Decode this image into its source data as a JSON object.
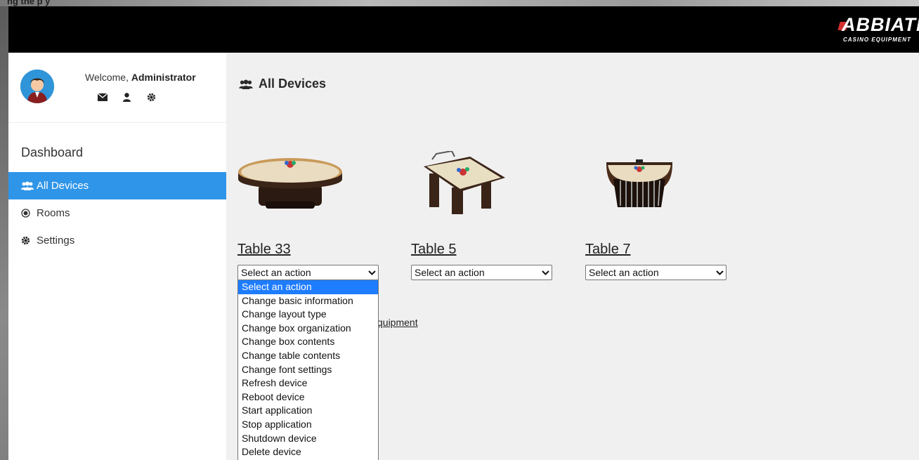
{
  "header": {
    "brand_name": "ABBIATI",
    "brand_tagline": "CASINO EQUIPMENT",
    "brand_color": "#d32f2f"
  },
  "background_caption": "ng the p                        y",
  "user": {
    "welcome_prefix": "Welcome, ",
    "name": "Administrator",
    "icons": [
      "envelope-icon",
      "user-icon",
      "gear-icon"
    ]
  },
  "sidebar": {
    "section_label": "Dashboard",
    "items": [
      {
        "label": "All Devices",
        "icon": "users-icon",
        "active": true
      },
      {
        "label": "Rooms",
        "icon": "radio-icon",
        "active": false
      },
      {
        "label": "Settings",
        "icon": "gear-icon",
        "active": false
      }
    ]
  },
  "main": {
    "title": "All Devices",
    "title_icon": "users-icon",
    "devices": [
      {
        "name": "Table 33",
        "action_value": "Select an action"
      },
      {
        "name": "Table 5",
        "action_value": "Select an action"
      },
      {
        "name": "Table 7",
        "action_value": "Select an action"
      }
    ],
    "partial_link": "quipment"
  },
  "action_dropdown": {
    "options": [
      "Select an action",
      "Change basic information",
      "Change layout type",
      "Change box organization",
      "Change box contents",
      "Change table contents",
      "Change font settings",
      "Refresh device",
      "Reboot device",
      "Start application",
      "Stop application",
      "Shutdown device",
      "Delete device"
    ],
    "selected_index": 0
  },
  "colors": {
    "accent": "#2f95e8",
    "header_bg": "#000000",
    "option_highlight": "#1e7cff"
  }
}
